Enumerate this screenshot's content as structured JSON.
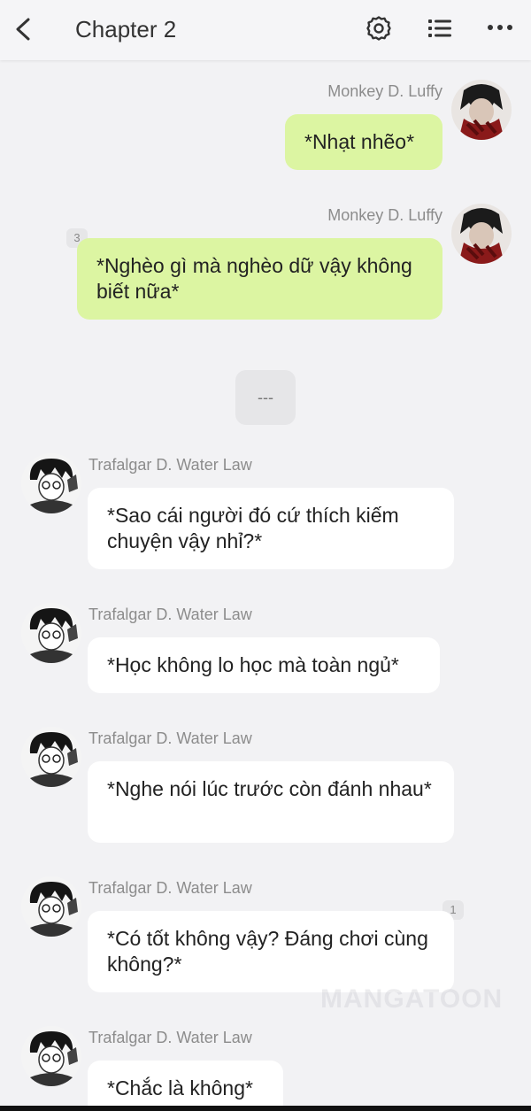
{
  "header": {
    "title": "Chapter 2"
  },
  "messages": [
    {
      "sender": "Monkey D. Luffy",
      "text": "*Nhạt nhẽo*"
    },
    {
      "sender": "Monkey D. Luffy",
      "text": "*Nghèo gì mà nghèo dữ vậy không biết nữa*",
      "badge": "3"
    },
    {
      "divider": "---"
    },
    {
      "sender": "Trafalgar D. Water Law",
      "text": "*Sao cái người đó cứ thích kiếm chuyện vậy nhỉ?*"
    },
    {
      "sender": "Trafalgar D. Water Law",
      "text": "*Học không lo học mà toàn ngủ*"
    },
    {
      "sender": "Trafalgar D. Water Law",
      "text": "*Nghe nói lúc trước còn đánh nhau*"
    },
    {
      "sender": "Trafalgar D. Water Law",
      "text": "*Có tốt không vậy? Đáng chơi cùng không?*",
      "badge": "1"
    },
    {
      "sender": "Trafalgar D. Water Law",
      "text": "*Chắc là không*"
    }
  ],
  "watermark": "MANGATOON",
  "colors": {
    "background": "#f2f2f4",
    "my_bubble": "#dcf5a2",
    "their_bubble": "#ffffff"
  },
  "icons": [
    "back-icon",
    "gear-icon",
    "list-icon",
    "more-icon"
  ]
}
